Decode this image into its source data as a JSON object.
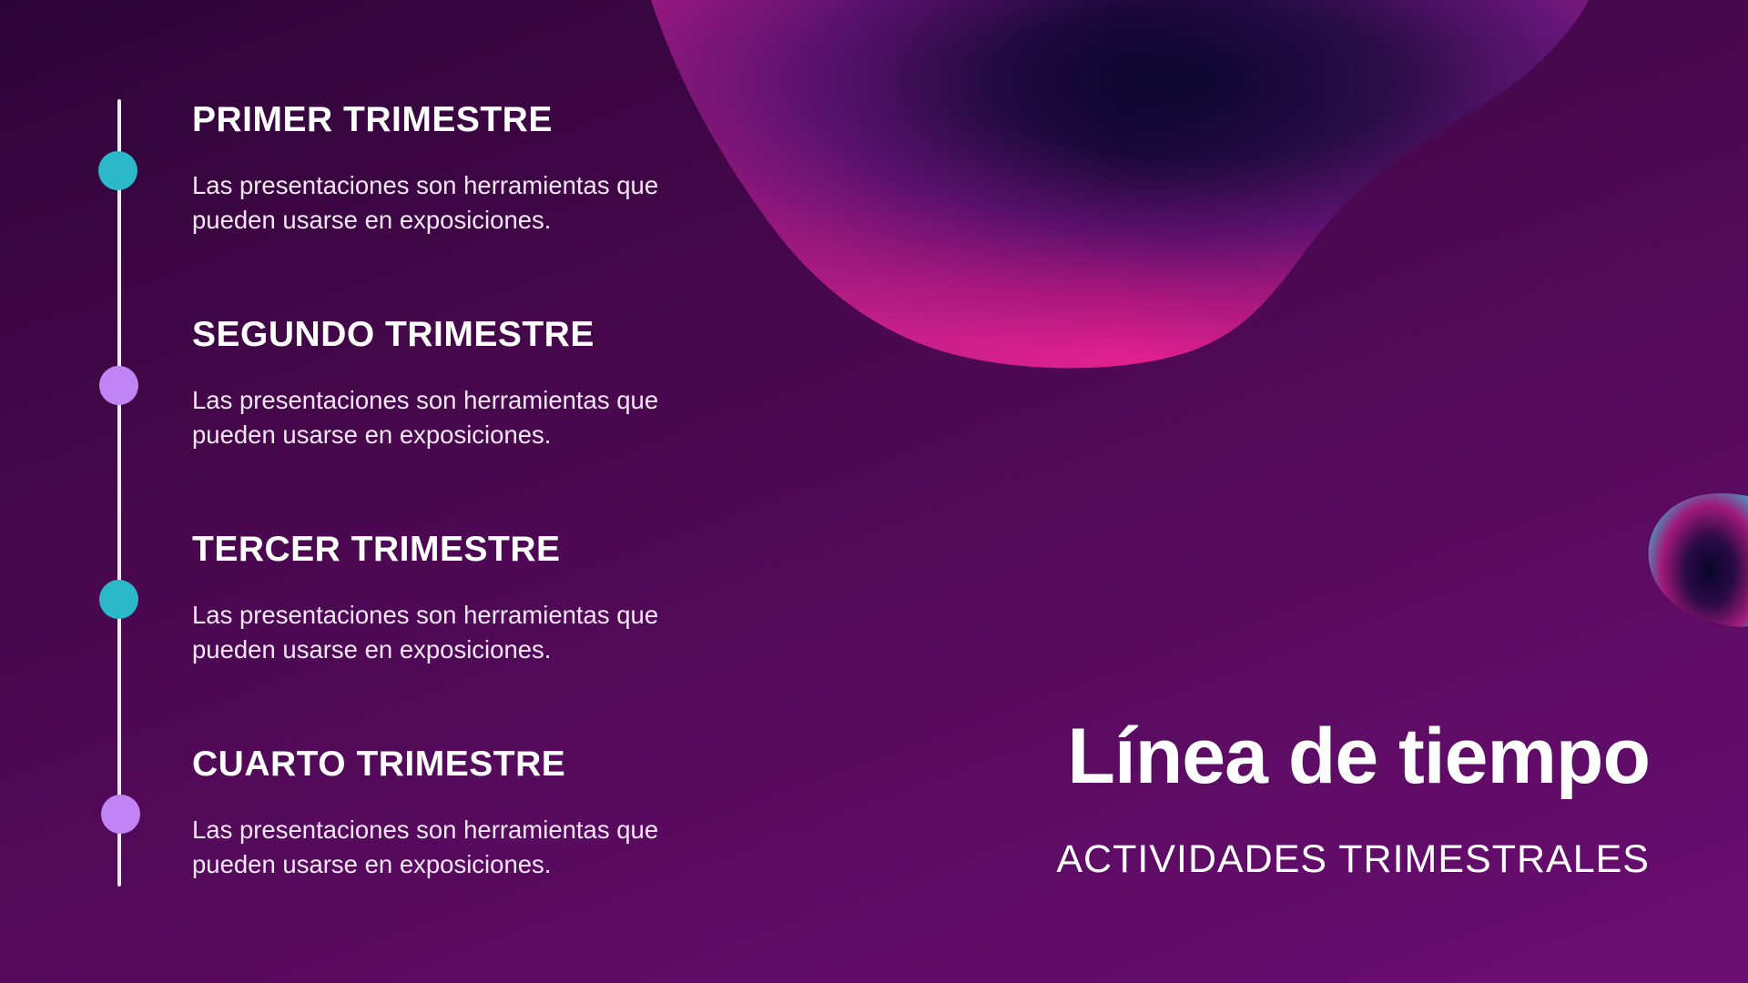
{
  "slide": {
    "title": "Línea de tiempo",
    "subtitle": "ACTIVIDADES TRIMESTRALES"
  },
  "timeline": {
    "items": [
      {
        "title": "PRIMER TRIMESTRE",
        "description": "Las presentaciones son herramientas que pueden usarse en exposiciones.",
        "dot_color": "#2bb8c9"
      },
      {
        "title": "SEGUNDO TRIMESTRE",
        "description": "Las presentaciones son herramientas que pueden usarse en exposiciones.",
        "dot_color": "#c084f5"
      },
      {
        "title": "TERCER TRIMESTRE",
        "description": "Las presentaciones son herramientas que pueden usarse en exposiciones.",
        "dot_color": "#2bb8c9"
      },
      {
        "title": "CUARTO TRIMESTRE",
        "description": "Las presentaciones son herramientas que pueden usarse en exposiciones.",
        "dot_color": "#c084f5"
      }
    ]
  },
  "colors": {
    "background_dark": "#2c0537",
    "background_light": "#6a0e72",
    "accent_pink": "#e0208f",
    "accent_teal": "#2bb8c9",
    "accent_lavender": "#c084f5"
  }
}
